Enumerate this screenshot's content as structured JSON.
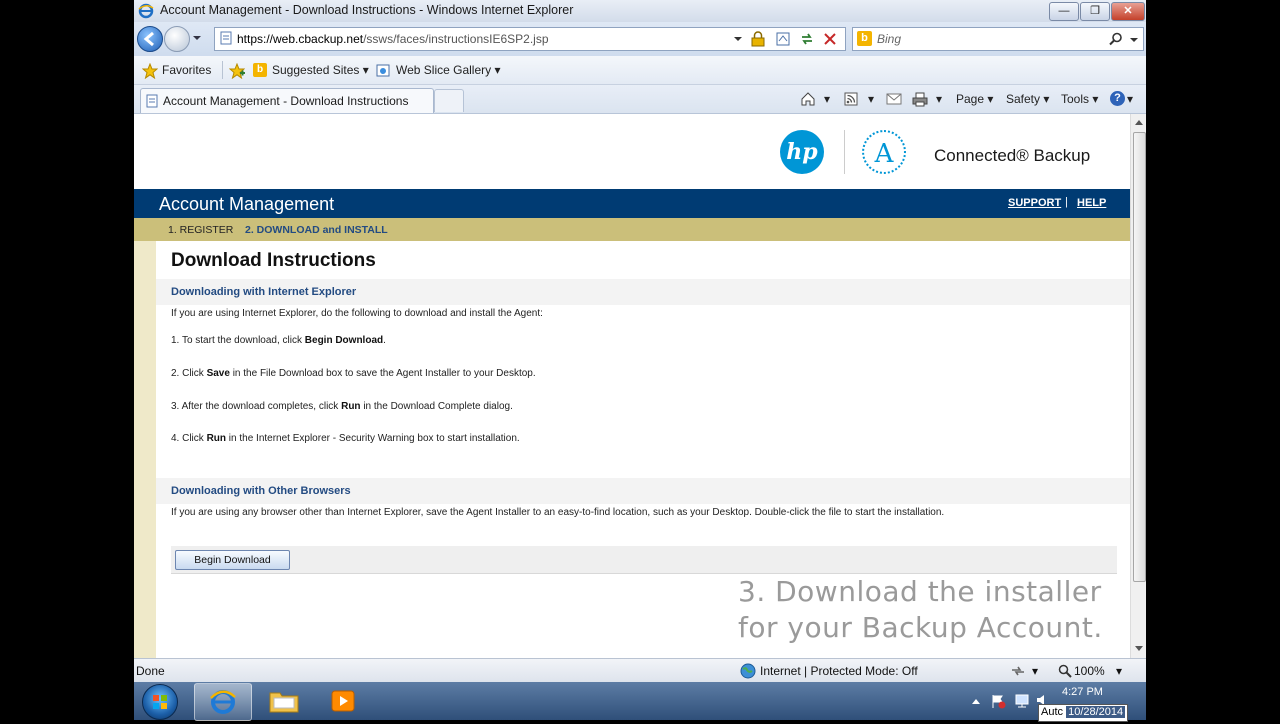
{
  "window": {
    "title": "Account Management - Download Instructions - Windows Internet Explorer",
    "url_prefix": "https://web.",
    "url_domain": "cbackup.net",
    "url_path": "/ssws/faces/instructionsIE6SP2.jsp",
    "search_placeholder": "Bing"
  },
  "favorites": {
    "favorites_label": "Favorites",
    "suggested_sites": "Suggested Sites",
    "web_slice_gallery": "Web Slice Gallery"
  },
  "tabs": [
    {
      "label": "Account Management - Download Instructions"
    }
  ],
  "commandbar": {
    "page": "Page",
    "safety": "Safety",
    "tools": "Tools"
  },
  "page": {
    "brand": "Connected® Backup",
    "hp_logo_text": "hp",
    "a_logo_text": "A",
    "header_title": "Account Management",
    "support": "SUPPORT",
    "separator": "|",
    "help": "HELP",
    "step1": "1. REGISTER",
    "step2": "2. DOWNLOAD and INSTALL",
    "title": "Download Instructions",
    "section_ie": "Downloading with Internet Explorer",
    "intro_ie": "If you are using Internet Explorer, do the following to download and install the Agent:",
    "step_lines": [
      {
        "pre": "1. To start the download, click ",
        "bold": "Begin Download",
        "post": "."
      },
      {
        "pre": "2. Click ",
        "bold": "Save",
        "post": " in the File Download box to save the Agent Installer to your Desktop."
      },
      {
        "pre": "3. After the download completes, click ",
        "bold": "Run",
        "post": " in the Download Complete dialog."
      },
      {
        "pre": "4. Click ",
        "bold": "Run",
        "post": " in the Internet Explorer - Security Warning box to start installation."
      }
    ],
    "section_other": "Downloading with Other Browsers",
    "intro_other": "If you are using any browser other than Internet Explorer, save the Agent Installer to an easy-to-find location, such as your Desktop. Double-click the file to start the installation.",
    "begin_download": "Begin Download"
  },
  "overlay": {
    "line1": "3. Download the installer",
    "line2": "for your Backup Account."
  },
  "statusbar": {
    "status": "Done",
    "zone": "Internet | Protected Mode: Off",
    "zoom": "100%"
  },
  "taskbar": {
    "time": "4:27 PM",
    "date": "10/28/2014",
    "tooltip": "Autc"
  },
  "colors": {
    "header_blue": "#003b73",
    "step_gold": "#cbbf7a",
    "hp_blue": "#0096d6",
    "section_text": "#234b82"
  }
}
